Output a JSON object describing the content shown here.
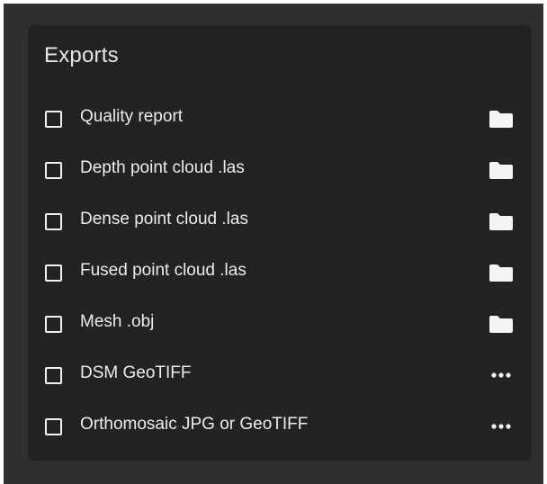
{
  "exports": {
    "title": "Exports",
    "items": [
      {
        "label": "Quality report",
        "checked": false,
        "action_icon": "folder-icon"
      },
      {
        "label": "Depth point cloud .las",
        "checked": false,
        "action_icon": "folder-icon"
      },
      {
        "label": "Dense point cloud .las",
        "checked": false,
        "action_icon": "folder-icon"
      },
      {
        "label": "Fused point cloud .las",
        "checked": false,
        "action_icon": "folder-icon"
      },
      {
        "label": "Mesh .obj",
        "checked": false,
        "action_icon": "folder-icon"
      },
      {
        "label": "DSM GeoTIFF",
        "checked": false,
        "action_icon": "more-options-icon"
      },
      {
        "label": "Orthomosaic JPG or GeoTIFF",
        "checked": false,
        "action_icon": "more-options-icon"
      }
    ]
  },
  "colors": {
    "background": "#2f2f2f",
    "panel": "#232323",
    "text": "#ececec"
  }
}
